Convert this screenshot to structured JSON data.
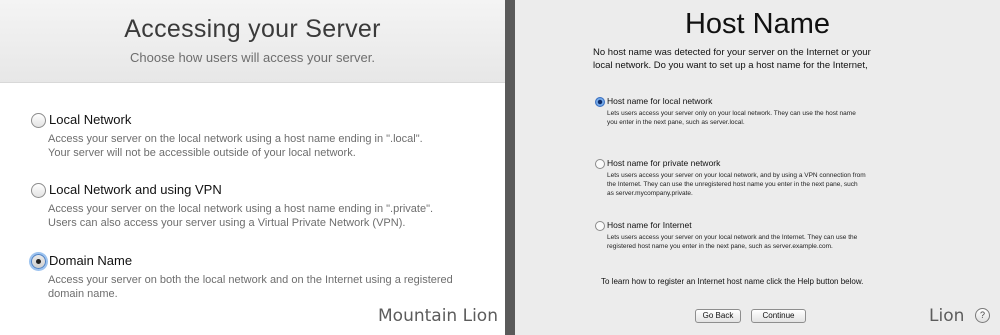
{
  "mountain_lion": {
    "title": "Accessing your Server",
    "subtitle": "Choose how users will access your server.",
    "options": [
      {
        "label": "Local Network",
        "desc_lines": [
          "Access your server on the local network using a host name ending in \".local\".",
          "Your server will not be accessible outside of your local network."
        ],
        "selected": false
      },
      {
        "label": "Local Network and using VPN",
        "desc_lines": [
          "Access your server on the local network using a host name ending in \".private\".",
          "Users can also access your server using a Virtual Private Network (VPN)."
        ],
        "selected": false
      },
      {
        "label": "Domain Name",
        "desc_lines": [
          "Access your server on both the local network and on the Internet using a registered",
          "domain name."
        ],
        "selected": true
      }
    ],
    "caption": "Mountain Lion"
  },
  "lion": {
    "title": "Host Name",
    "intro_lines": [
      "No host name was detected for your server on the Internet or your",
      "local network. Do you want to set up a host name for the Internet,"
    ],
    "options": [
      {
        "label": "Host name for local network",
        "desc_lines": [
          "Lets users access your server only on your local network. They can use the host name",
          "you enter in the next pane, such as server.local."
        ],
        "selected": true
      },
      {
        "label": "Host name for private network",
        "desc_lines": [
          "Lets users access your server on your local network, and by using a VPN connection from",
          "the Internet. They can use the unregistered host name you enter in the next pane, such",
          "as server.mycompany.private."
        ],
        "selected": false
      },
      {
        "label": "Host name for Internet",
        "desc_lines": [
          "Lets users access your server on your local network and the Internet. They can use the",
          "registered host name you enter in the next pane, such as server.example.com."
        ],
        "selected": false
      }
    ],
    "help_text": "To learn how to register an Internet host name click the Help button below.",
    "buttons": {
      "back": "Go Back",
      "continue": "Continue"
    },
    "help_glyph": "?",
    "caption": "Lion"
  },
  "colors": {
    "selected_radio": "#4a7fc4",
    "background_left": "#ffffff",
    "background_right": "#ececec"
  }
}
